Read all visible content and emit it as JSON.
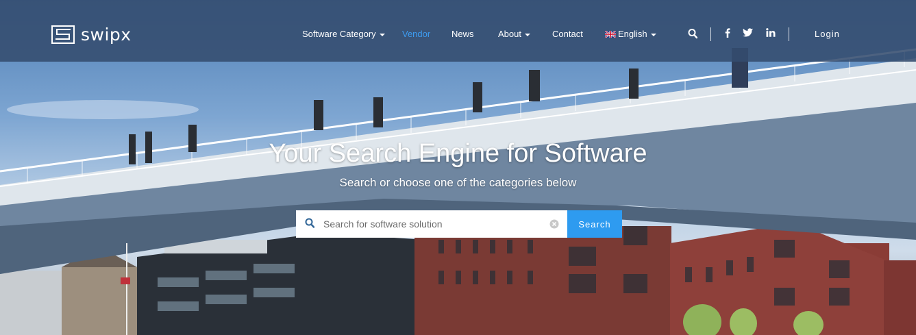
{
  "brand": {
    "name": "swipx"
  },
  "colors": {
    "accent": "#2e9bf0",
    "active_link": "#3d9cf0",
    "navbar_bg": "#344c6e"
  },
  "nav": {
    "items": [
      {
        "label": "Software Category",
        "dropdown": true
      },
      {
        "label": "Vendor",
        "active": true
      },
      {
        "label": "News"
      },
      {
        "label": "About",
        "dropdown": true
      },
      {
        "label": "Contact"
      }
    ],
    "language": {
      "label": "English",
      "flag_icon": "uk-flag-icon"
    },
    "login_label": "Login",
    "icons": [
      "search-icon",
      "facebook-icon",
      "twitter-icon",
      "linkedin-icon"
    ]
  },
  "hero": {
    "title": "Your Search Engine for Software",
    "subtitle": "Search or choose one of the categories below"
  },
  "search": {
    "placeholder": "Search for software solution",
    "value": "",
    "button_label": "Search"
  }
}
